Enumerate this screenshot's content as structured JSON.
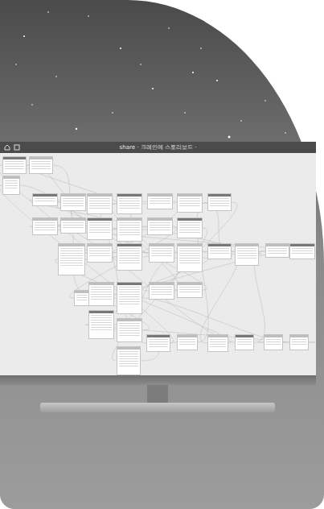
{
  "window": {
    "title": "share · 크레인에 스토리보드 ·"
  }
}
